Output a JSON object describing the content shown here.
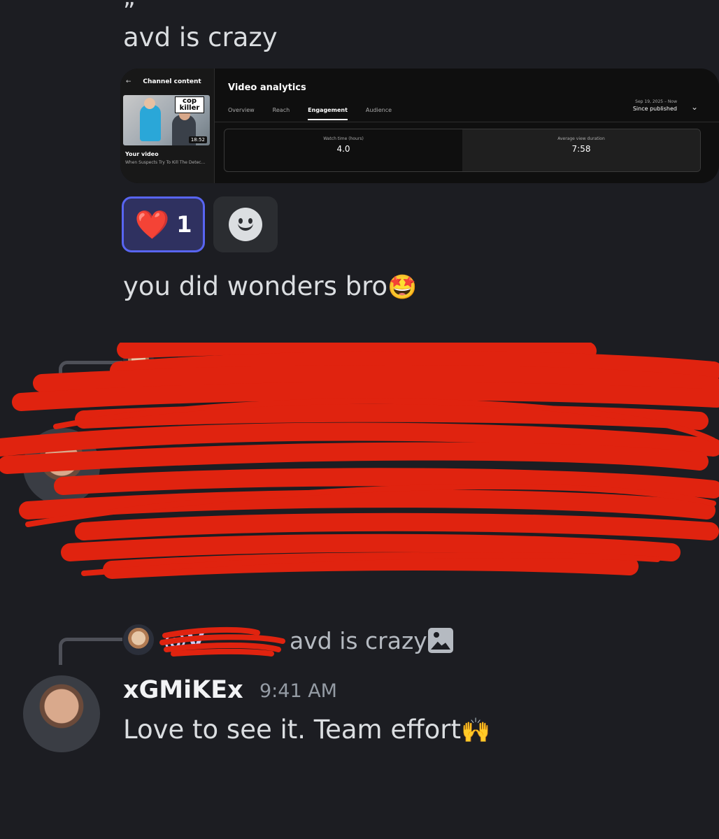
{
  "chat": {
    "top_cut_text": "„ ” “ ’",
    "message_avd": "avd is crazy",
    "message_wonders": "you did wonders bro",
    "message_wonders_emoji": "🤩",
    "reactions": [
      {
        "emoji": "❤️",
        "count": "1",
        "selected": true
      },
      {
        "icon": "add-reaction-icon"
      }
    ],
    "reply": {
      "mention": "@V",
      "text": "avd is crazy",
      "attachment_icon": "image-icon"
    },
    "message_last": {
      "username": "xGMiKEx",
      "timestamp": "9:41 AM",
      "text": "Love to see it. Team effort",
      "emoji": "🙌"
    }
  },
  "attachment": {
    "sidebar": {
      "back_label": "←",
      "title": "Channel content",
      "thumbnail_caption": "cop killer",
      "duration": "18:52",
      "your_video": "Your video",
      "video_title": "When Suspects Try To Kill The Detec..."
    },
    "header": "Video analytics",
    "tabs": [
      "Overview",
      "Reach",
      "Engagement",
      "Audience"
    ],
    "active_tab": "Engagement",
    "date_range": "Sep 19, 2025 – Now",
    "date_label": "Since published",
    "metrics": [
      {
        "label": "Watch time (hours)",
        "value": "4.0"
      },
      {
        "label": "Average view duration",
        "value": "7:58"
      }
    ]
  },
  "colors": {
    "background": "#1c1d22",
    "censor_red": "#e0230f",
    "reaction_selected_border": "#5865f2"
  }
}
